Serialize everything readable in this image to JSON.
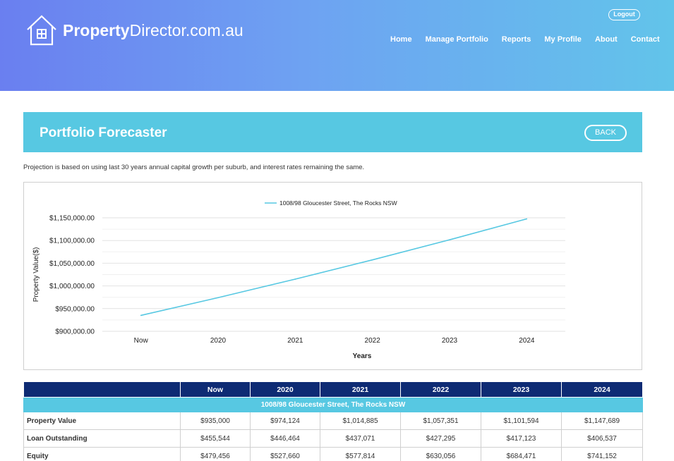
{
  "header": {
    "logo_bold": "Property",
    "logo_rest": "Director.com.au",
    "logout_label": "Logout",
    "nav": [
      "Home",
      "Manage Portfolio",
      "Reports",
      "My Profile",
      "About",
      "Contact"
    ]
  },
  "banner": {
    "title": "Portfolio Forecaster",
    "back_label": "BACK"
  },
  "note": "Projection is based on using last 30 years annual capital growth per suburb, and interest rates remaining the same.",
  "chart_data": {
    "type": "line",
    "categories": [
      "Now",
      "2020",
      "2021",
      "2022",
      "2023",
      "2024"
    ],
    "series": [
      {
        "name": "1008/98 Gloucester Street, The Rocks NSW",
        "values": [
          935000,
          974124,
          1014885,
          1057351,
          1101594,
          1147689
        ],
        "color": "#57c8e2"
      }
    ],
    "ylim": [
      900000,
      1150000
    ],
    "yticks": [
      "$1,150,000.00",
      "$1,100,000.00",
      "$1,050,000.00",
      "$1,000,000.00",
      "$950,000.00",
      "$900,000.00"
    ],
    "ytick_values": [
      1150000,
      1100000,
      1050000,
      1000000,
      950000,
      900000
    ],
    "xlabel": "Years",
    "ylabel": "Property Value($)",
    "legend": "top",
    "grid": true
  },
  "table": {
    "headers": [
      "",
      "Now",
      "2020",
      "2021",
      "2022",
      "2023",
      "2024"
    ],
    "group_label": "1008/98 Gloucester Street, The Rocks NSW",
    "rows": [
      {
        "label": "Property Value",
        "values": [
          "$935,000",
          "$974,124",
          "$1,014,885",
          "$1,057,351",
          "$1,101,594",
          "$1,147,689"
        ]
      },
      {
        "label": "Loan Outstanding",
        "values": [
          "$455,544",
          "$446,464",
          "$437,071",
          "$427,295",
          "$417,123",
          "$406,537"
        ]
      },
      {
        "label": "Equity",
        "values": [
          "$479,456",
          "$527,660",
          "$577,814",
          "$630,056",
          "$684,471",
          "$741,152"
        ]
      }
    ]
  },
  "colors": {
    "header_start": "#6a7ff0",
    "header_end": "#62c4ea",
    "banner": "#57c8e2",
    "table_header": "#0e2b74"
  }
}
